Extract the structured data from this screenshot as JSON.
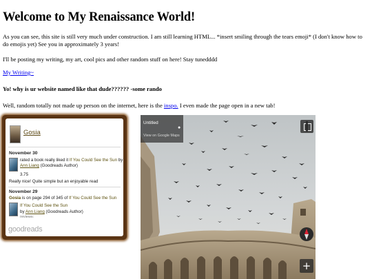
{
  "heading": "Welcome to My Renaissance World!",
  "intro": "As you can see, this site is still very much under construction. I am still learning HTML... *insert smiling through the tears emoji* (I don't know how to do emojis yet) See you in approximately 3 years!",
  "posting_note": "I'll be posting my writing, my art, cool pics and other random stuff on here! Stay tunedddd",
  "writing_link": "My Writing~",
  "question": "Yo! why is ur website named like that dude?????? -some rando",
  "answer": {
    "before": "Well, random totally not made up person on the internet, here is the ",
    "link": "inspo.",
    "after": " I even made the page open in a new tab!"
  },
  "goodreads": {
    "user_name": "Gosia",
    "entries": [
      {
        "date": "November 30",
        "line1_pre": "rated a book really liked it ",
        "book_title": "If You Could See the Sun",
        "line1_post": " by",
        "author_name": "Ann Liang",
        "author_note": " (Goodreads Author)",
        "rating": "3.75",
        "review": "Really nice! Quite simple but an enjoyable read"
      },
      {
        "date": "November 29",
        "user_name": "Gosia",
        "progress_text": " is on page 294 of 345 of ",
        "book_title": "If You Could See the Sun",
        "book_title_2": "If You Could See the Sun",
        "by_text": "by ",
        "author_name": "Ann Liang",
        "author_note": " (Goodreads Author)",
        "cut_text": "reviews:"
      }
    ],
    "logo": "goodreads"
  },
  "streetview": {
    "title": "Untitled",
    "link": "View on Google Maps",
    "zoom_label": "+"
  }
}
